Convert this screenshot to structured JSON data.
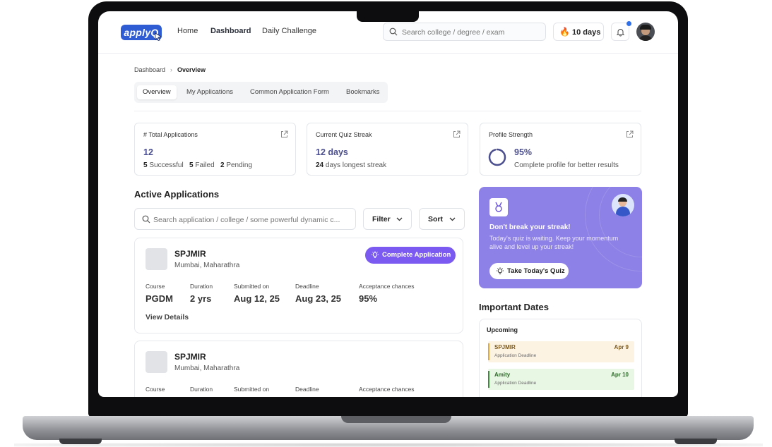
{
  "nav": {
    "logo": "applyQ",
    "links": [
      "Home",
      "Dashboard",
      "Daily Challenge"
    ],
    "search_placeholder": "Search college / degree / exam",
    "streak": "10 days"
  },
  "breadcrumb": {
    "root": "Dashboard",
    "current": "Overview"
  },
  "tabs": [
    "Overview",
    "My Applications",
    "Common Application Form",
    "Bookmarks"
  ],
  "stats": [
    {
      "label": "# Total Applications",
      "value": "12",
      "sub": [
        {
          "n": "5",
          "t": "Successful"
        },
        {
          "n": "5",
          "t": "Failed"
        },
        {
          "n": "2",
          "t": "Pending"
        }
      ]
    },
    {
      "label": "Current Quiz Streak",
      "value": "12 days",
      "sub_n": "24",
      "sub_t": "days longest streak"
    },
    {
      "label": "Profile Strength",
      "value": "95%",
      "sub_t": "Complete profile for better results",
      "progress": 0.95
    }
  ],
  "active": {
    "title": "Active Applications",
    "search_placeholder": "Search application / college / some powerful dynamic c...",
    "filter": "Filter",
    "sort": "Sort",
    "columns": [
      "Course",
      "Duration",
      "Submitted on",
      "Deadline",
      "Acceptance chances"
    ],
    "cta": "Complete Application",
    "details": "View Details",
    "cards": [
      {
        "name": "SPJMIR",
        "loc": "Mumbai, Maharathra",
        "values": [
          "PGDM",
          "2 yrs",
          "Aug 12, 25",
          "Aug 23, 25",
          "95%"
        ]
      },
      {
        "name": "SPJMIR",
        "loc": "Mumbai, Maharathra",
        "values": [
          "",
          "",
          "",
          "",
          ""
        ]
      }
    ]
  },
  "promo": {
    "title": "Don't break your streak!",
    "desc": "Today's quiz is waiting. Keep your momentum alive and level up your streak!",
    "button": "Take Today's Quiz"
  },
  "dates": {
    "title": "Important Dates",
    "upcoming": "Upcoming",
    "items": [
      {
        "name": "SPJMIR",
        "sub": "Application Deadline",
        "date": "Apr 9",
        "bg": "#fdf3e3",
        "bar": "#e1a640",
        "fg": "#7a5a1f"
      },
      {
        "name": "Amity",
        "sub": "Application Deadline",
        "date": "Apr 10",
        "bg": "#e8f6e4",
        "bar": "#3f8a3a",
        "fg": "#2e6b2a"
      }
    ]
  },
  "colors": {
    "accent": "#7a5af0",
    "promo": "#8d80e6",
    "stat_value": "#4c4f8f"
  }
}
